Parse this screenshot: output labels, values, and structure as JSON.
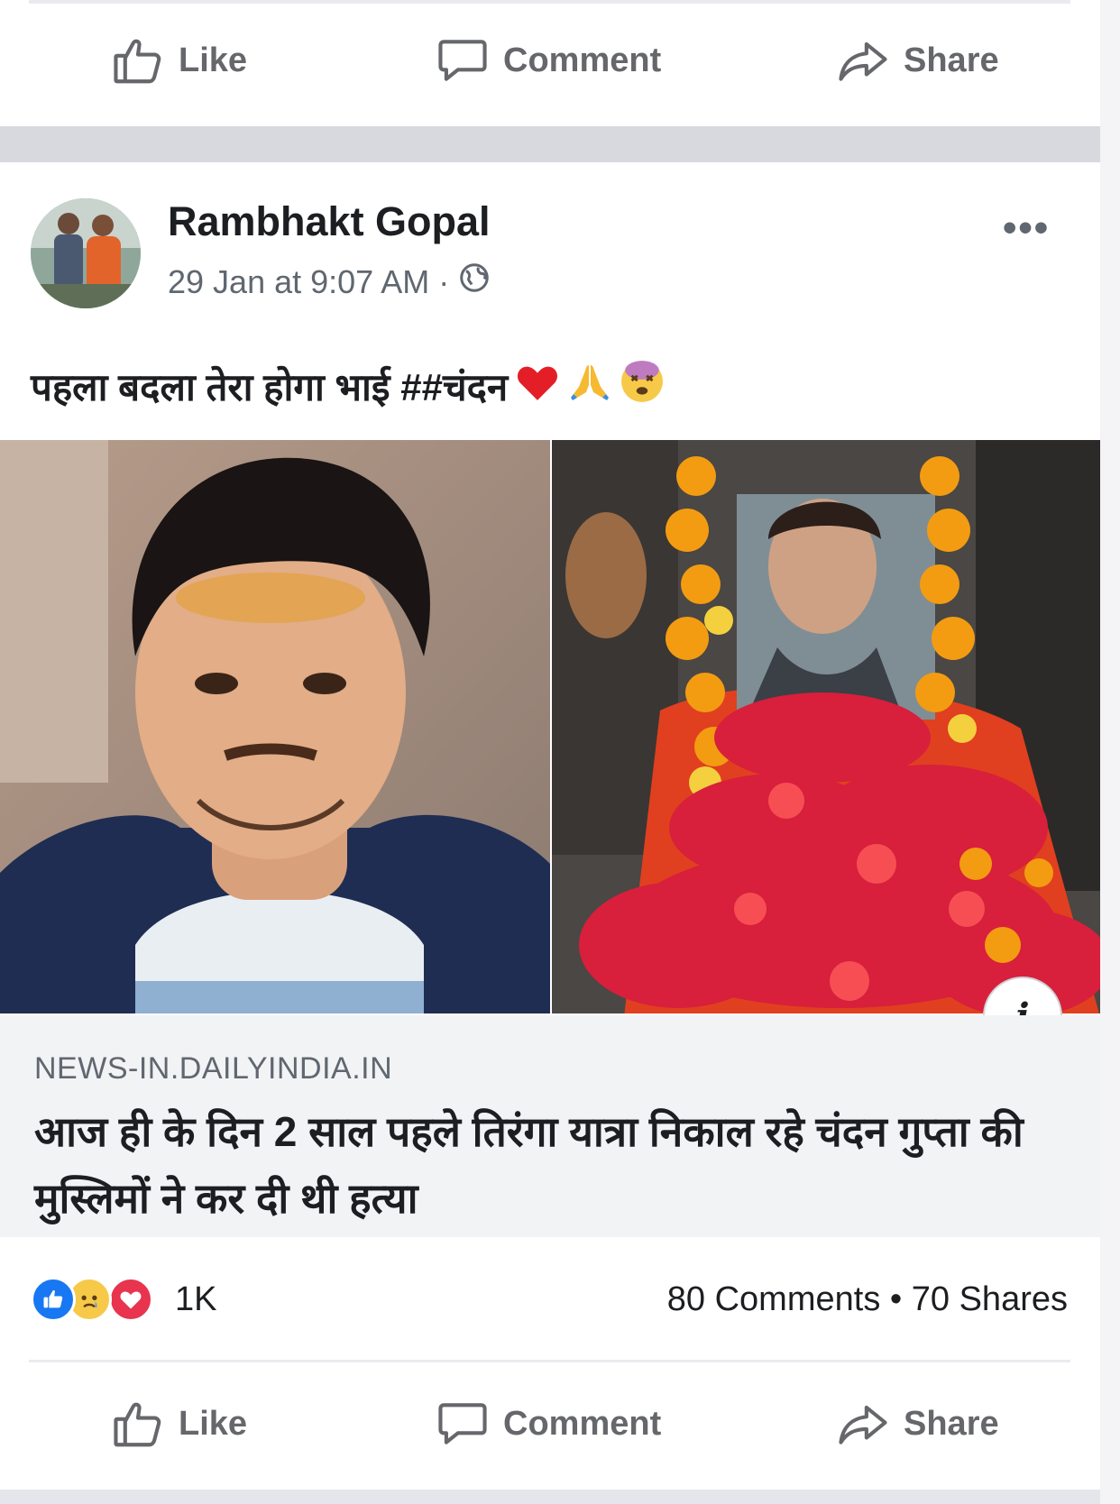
{
  "actions": {
    "like": "Like",
    "comment": "Comment",
    "share": "Share"
  },
  "post": {
    "author": "Rambhakt Gopal",
    "timestamp": "29 Jan at 9:07 AM",
    "separator": "·",
    "privacy_icon": "globe-icon",
    "more_label": "•••",
    "text": "पहला बदला तेरा होगा भाई ##चंदन",
    "emojis": [
      "❤",
      "🙏",
      "😵"
    ]
  },
  "link_preview": {
    "domain": "NEWS-IN.DAILYINDIA.IN",
    "title": "आज ही के दिन 2 साल पहले तिरंगा यात्रा निकाल रहे चंदन गुप्ता की मुस्लिमों ने कर दी थी हत्या",
    "info_label": "i"
  },
  "engagement": {
    "reactions": [
      "like",
      "sad",
      "love"
    ],
    "reaction_count": "1K",
    "comments": "80 Comments",
    "dot": "•",
    "shares": "70 Shares"
  },
  "colors": {
    "action_gray": "#65676b",
    "like_blue": "#1877f2",
    "love_red": "#e8344e",
    "sad_yellow": "#f7c948",
    "band_gray": "#d7d9de"
  }
}
